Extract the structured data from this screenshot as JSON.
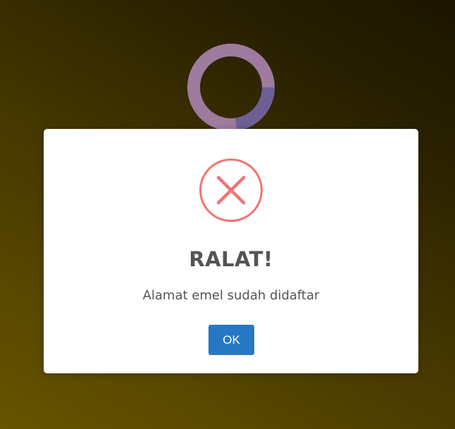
{
  "colors": {
    "background_top_right": "#1e1700",
    "background_bottom_left": "#6e5a00",
    "modal_background": "#ffffff",
    "error_icon": "#f27474",
    "title_text": "#545454",
    "message_text": "#545454",
    "button_background": "#2778c4",
    "button_text": "#ffffff",
    "loader_ring": "#9e7b9e",
    "loader_ring_accent": "#6d5f95"
  },
  "loader": {
    "icon": "loading-spinner-icon"
  },
  "dialog": {
    "icon": "error-x-circle-icon",
    "title": "RALAT!",
    "message": "Alamat emel sudah didaftar",
    "confirm_label": "OK"
  }
}
